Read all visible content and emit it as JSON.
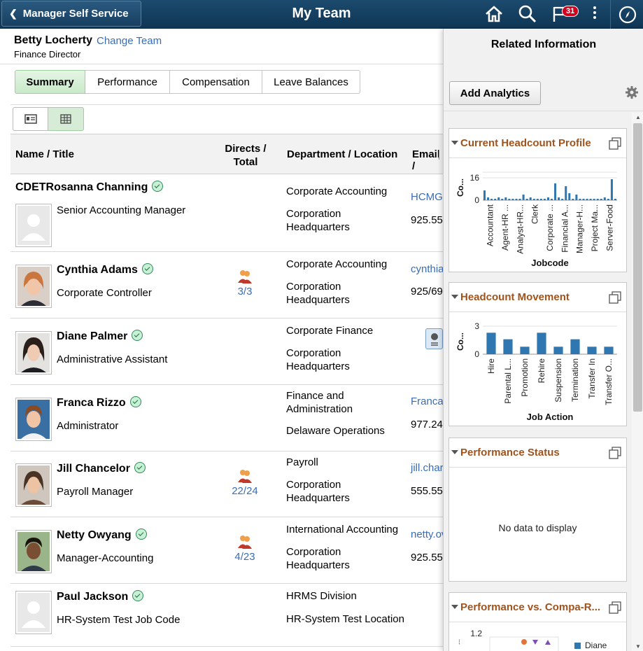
{
  "header": {
    "back_label": "Manager Self Service",
    "title": "My Team",
    "notification_count": "31"
  },
  "manager": {
    "name": "Betty Locherty",
    "change_team": "Change Team",
    "title": "Finance Director"
  },
  "tabs": [
    {
      "label": "Summary",
      "active": true
    },
    {
      "label": "Performance",
      "active": false
    },
    {
      "label": "Compensation",
      "active": false
    },
    {
      "label": "Leave Balances",
      "active": false
    }
  ],
  "grid": {
    "headers": {
      "name": "Name / Title",
      "directs_line1": "Directs /",
      "directs_line2": "Total",
      "department": "Department / Location",
      "email": "Email /"
    },
    "rows": [
      {
        "name": "CDETRosanna Channing",
        "title": "Senior Accounting Manager",
        "dept": "Corporate Accounting",
        "loc_line1": "Corporation",
        "loc_line2": "Headquarters",
        "email": "HCMGI",
        "phone": "925.55",
        "directs": ""
      },
      {
        "name": "Cynthia Adams",
        "title": "Corporate Controller",
        "dept": "Corporate Accounting",
        "loc_line1": "Corporation",
        "loc_line2": "Headquarters",
        "email": "cynthia",
        "phone": "925/69",
        "directs": "3/3"
      },
      {
        "name": "Diane Palmer",
        "title": "Administrative Assistant",
        "dept": "Corporate Finance",
        "loc_line1": "Corporation",
        "loc_line2": "Headquarters",
        "email": "",
        "phone": "",
        "directs": ""
      },
      {
        "name": "Franca Rizzo",
        "title": "Administrator",
        "dept_line1": "Finance and",
        "dept_line2": "Administration",
        "loc": "Delaware Operations",
        "email": "Franca",
        "phone": "977.24",
        "directs": ""
      },
      {
        "name": "Jill Chancelor",
        "title": "Payroll Manager",
        "dept": "Payroll",
        "loc_line1": "Corporation",
        "loc_line2": "Headquarters",
        "email": "jill.char",
        "phone": "555.55",
        "directs": "22/24"
      },
      {
        "name": "Netty Owyang",
        "title": "Manager-Accounting",
        "dept": "International Accounting",
        "loc_line1": "Corporation",
        "loc_line2": "Headquarters",
        "email": "netty.ov",
        "phone": "925.55",
        "directs": "4/23"
      },
      {
        "name": "Paul Jackson",
        "title": "HR-System Test Job Code",
        "dept": "HRMS Division",
        "loc": "HR-System Test Location",
        "email": "",
        "phone": "",
        "directs": ""
      }
    ]
  },
  "panel": {
    "title": "Related Information",
    "add_analytics": "Add Analytics",
    "cards": [
      {
        "title": "Current Headcount Profile"
      },
      {
        "title": "Headcount Movement"
      },
      {
        "title": "Performance Status",
        "empty_text": "No data to display"
      },
      {
        "title": "Performance vs. Compa-R..."
      }
    ]
  },
  "chart_data": [
    {
      "type": "bar",
      "title": "Current Headcount Profile",
      "xlabel": "Jobcode",
      "ylabel": "Co...",
      "yticks": [
        "16",
        "0"
      ],
      "ylim": [
        0,
        20
      ],
      "category_labels": [
        "Accountant",
        "Agent-HR ...",
        "Analyst-HR...",
        "Clerk",
        "Corporate ...",
        "Financial A...",
        "Manager-H...",
        "Project Ma...",
        "Server-Food"
      ],
      "values": [
        7,
        2,
        1,
        1,
        2,
        1,
        2,
        1,
        1,
        1,
        1,
        4,
        1,
        2,
        1,
        1,
        1,
        1,
        2,
        1,
        12,
        2,
        1,
        10,
        5,
        1,
        4,
        1,
        1,
        1,
        1,
        1,
        1,
        1,
        2,
        1,
        15,
        1
      ],
      "color": "#2f77b1"
    },
    {
      "type": "bar",
      "title": "Headcount Movement",
      "xlabel": "Job Action",
      "ylabel": "Co...",
      "yticks": [
        "3",
        "0"
      ],
      "ylim": [
        0,
        3
      ],
      "categories": [
        "Hire",
        "Parental L...",
        "Promotion",
        "Rehire",
        "Suspension",
        "Termination",
        "Transfer In",
        "Transfer O..."
      ],
      "values": [
        2.3,
        1.6,
        0.8,
        2.3,
        0.8,
        1.6,
        0.8,
        0.8
      ],
      "color": "#2f77b1"
    },
    {
      "type": "scatter",
      "title": "Performance vs. Compa-R...",
      "yticks": [
        "1.2"
      ],
      "legend": [
        "Diane"
      ]
    }
  ]
}
